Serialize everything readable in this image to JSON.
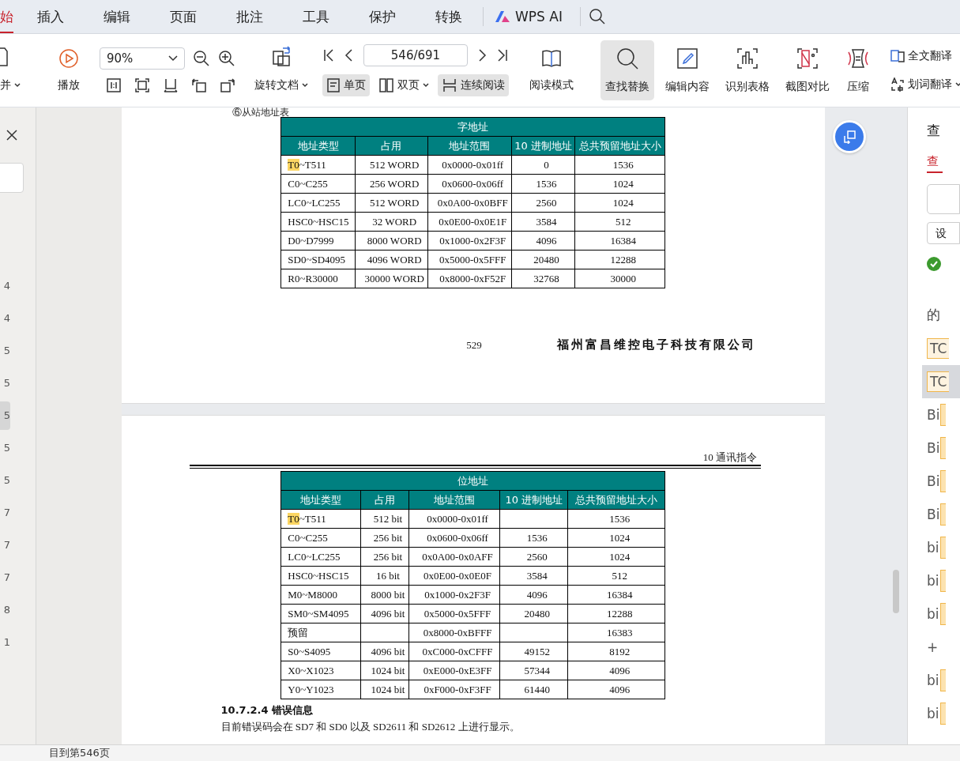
{
  "menu_tabs": [
    {
      "label": "始",
      "selected": true
    },
    {
      "label": "插入",
      "selected": false
    },
    {
      "label": "编辑",
      "selected": false
    },
    {
      "label": "页面",
      "selected": false
    },
    {
      "label": "批注",
      "selected": false
    },
    {
      "label": "工具",
      "selected": false
    },
    {
      "label": "保护",
      "selected": false
    },
    {
      "label": "转换",
      "selected": false
    }
  ],
  "ai_button": "WPS AI",
  "toolbar": {
    "merge": "并",
    "play": "播放",
    "zoom": "90%",
    "rotate": "旋转文档",
    "page_field": "546/691",
    "views": [
      {
        "label": "单页",
        "kind": "single",
        "selected": true,
        "caret": false
      },
      {
        "label": "双页",
        "kind": "double",
        "selected": false,
        "caret": true
      },
      {
        "label": "连续阅读",
        "kind": "continuous",
        "selected": true,
        "caret": false
      }
    ],
    "read_mode": "阅读模式",
    "tools": [
      {
        "label": "查找替换",
        "kind": "search",
        "selected": true
      },
      {
        "label": "编辑内容",
        "kind": "edit",
        "selected": false
      },
      {
        "label": "识别表格",
        "kind": "table",
        "selected": false
      },
      {
        "label": "截图对比",
        "kind": "compare",
        "selected": false
      },
      {
        "label": "压缩",
        "kind": "compress",
        "selected": false
      }
    ],
    "translate": [
      "全文翻译",
      "划词翻译"
    ]
  },
  "left_panel": {
    "pages": [
      {
        "label": "4",
        "selected": false
      },
      {
        "label": "4",
        "selected": false
      },
      {
        "label": "5",
        "selected": false
      },
      {
        "label": "5",
        "selected": false
      },
      {
        "label": "5",
        "selected": true
      },
      {
        "label": "5",
        "selected": false
      },
      {
        "label": "5",
        "selected": false
      },
      {
        "label": "7",
        "selected": false
      },
      {
        "label": "7",
        "selected": false
      },
      {
        "label": "7",
        "selected": false
      },
      {
        "label": "8",
        "selected": false
      },
      {
        "label": "1",
        "selected": false
      }
    ]
  },
  "page1": {
    "caption": "⑥从站地址表",
    "table": {
      "title": "字地址",
      "columns": [
        "地址类型",
        "占用",
        "地址范围",
        "10 进制地址",
        "总共预留地址大小"
      ],
      "rows": [
        [
          {
            "mark": "T0",
            "rest": "~T511"
          },
          "512 WORD",
          "0x0000-0x01ff",
          "0",
          "1536"
        ],
        [
          "C0~C255",
          "256 WORD",
          "0x0600-0x06ff",
          "1536",
          "1024"
        ],
        [
          "LC0~LC255",
          "512 WORD",
          "0x0A00-0x0BFF",
          "2560",
          "1024"
        ],
        [
          "HSC0~HSC15",
          "32 WORD",
          "0x0E00-0x0E1F",
          "3584",
          "512"
        ],
        [
          "D0~D7999",
          "8000 WORD",
          "0x1000-0x2F3F",
          "4096",
          "16384"
        ],
        [
          "SD0~SD4095",
          "4096 WORD",
          "0x5000-0x5FFF",
          "20480",
          "12288"
        ],
        [
          "R0~R30000",
          "30000 WORD",
          "0x8000-0xF52F",
          "32768",
          "30000"
        ]
      ]
    },
    "page_number": "529",
    "company": "福州富昌维控电子科技有限公司"
  },
  "page2": {
    "header": "10 通讯指令",
    "table": {
      "title": "位地址",
      "columns": [
        "地址类型",
        "占用",
        "地址范围",
        "10 进制地址",
        "总共预留地址大小"
      ],
      "rows": [
        [
          {
            "mark": "T0",
            "rest": "~T511"
          },
          "512 bit",
          "0x0000-0x01ff",
          "",
          "1536"
        ],
        [
          "C0~C255",
          "256 bit",
          "0x0600-0x06ff",
          "1536",
          "1024"
        ],
        [
          "LC0~LC255",
          "256 bit",
          "0x0A00-0x0AFF",
          "2560",
          "1024"
        ],
        [
          "HSC0~HSC15",
          "16 bit",
          "0x0E00-0x0E0F",
          "3584",
          "512"
        ],
        [
          "M0~M8000",
          "8000 bit",
          "0x1000-0x2F3F",
          "4096",
          "16384"
        ],
        [
          "SM0~SM4095",
          "4096 bit",
          "0x5000-0x5FFF",
          "20480",
          "12288"
        ],
        [
          "预留",
          "",
          "0x8000-0xBFFF",
          "",
          "16383"
        ],
        [
          "S0~S4095",
          "4096 bit",
          "0xC000-0xCFFF",
          "49152",
          "8192"
        ],
        [
          "X0~X1023",
          "1024 bit",
          "0xE000-0xE3FF",
          "57344",
          "4096"
        ],
        [
          "Y0~Y1023",
          "1024 bit",
          "0xF000-0xF3FF",
          "61440",
          "4096"
        ]
      ]
    },
    "heading": "10.7.2.4 错误信息",
    "body": "目前错误码会在 SD7 和 SD0 以及 SD2611 和 SD2612 上进行显示。"
  },
  "right_panel": {
    "title": "查",
    "tab": "查",
    "option": "设",
    "summary": "的",
    "results": [
      {
        "text": "TC",
        "kind": "boxed",
        "selected": false
      },
      {
        "text": "TC",
        "kind": "boxed",
        "selected": true
      },
      {
        "text": "Bi",
        "kind": "trailing",
        "selected": false
      },
      {
        "text": "Bi",
        "kind": "trailing",
        "selected": false
      },
      {
        "text": "Bi",
        "kind": "trailing",
        "selected": false
      },
      {
        "text": "Bi",
        "kind": "trailing",
        "selected": false
      },
      {
        "text": "bi",
        "kind": "trailing",
        "selected": false
      },
      {
        "text": "bi",
        "kind": "trailing",
        "selected": false
      },
      {
        "text": "bi",
        "kind": "trailing",
        "selected": false
      },
      {
        "text": "+",
        "kind": "plain",
        "selected": false
      },
      {
        "text": "bi",
        "kind": "trailing",
        "selected": false
      },
      {
        "text": "bi",
        "kind": "trailing",
        "selected": false
      }
    ]
  },
  "status_bar": {
    "text": "目到第546页"
  }
}
